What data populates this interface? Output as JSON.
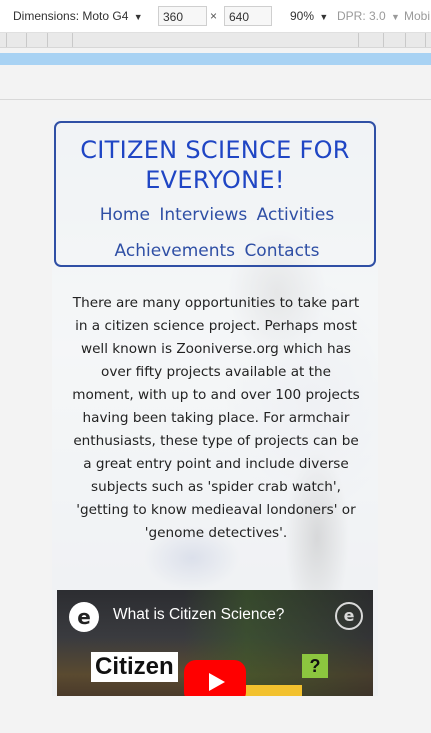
{
  "devtools": {
    "device_label": "Dimensions: Moto G4",
    "caret": "▼",
    "width_value": "360",
    "times": "×",
    "height_value": "640",
    "zoom": "90%",
    "dpr": "DPR: 3.0",
    "mobile": "Mobi"
  },
  "site": {
    "title": "CITIZEN SCIENCE FOR EVERYONE!",
    "nav": [
      {
        "label": "Home"
      },
      {
        "label": "Interviews"
      },
      {
        "label": "Activities"
      },
      {
        "label": "Achievements"
      },
      {
        "label": "Contacts"
      }
    ],
    "intro": "There are many opportunities to take part in a citizen science project. Perhaps most well known is Zooniverse.org which has over fifty projects available at the moment, with up to and over 100 projects having been taking place. For armchair enthusiasts, these type of projects can be a great entry point and include diverse subjects such as 'spider crab watch', 'getting to know medieaval londoners' or 'genome detectives'.",
    "colors": {
      "accent": "#1f45c4",
      "border": "#2f4fa5"
    }
  },
  "video": {
    "title": "What is Citizen Science?",
    "thumb_word": "Citizen",
    "thumb_qmark": "?",
    "logo_letter": "e",
    "play_icon": "youtube-play-icon"
  }
}
